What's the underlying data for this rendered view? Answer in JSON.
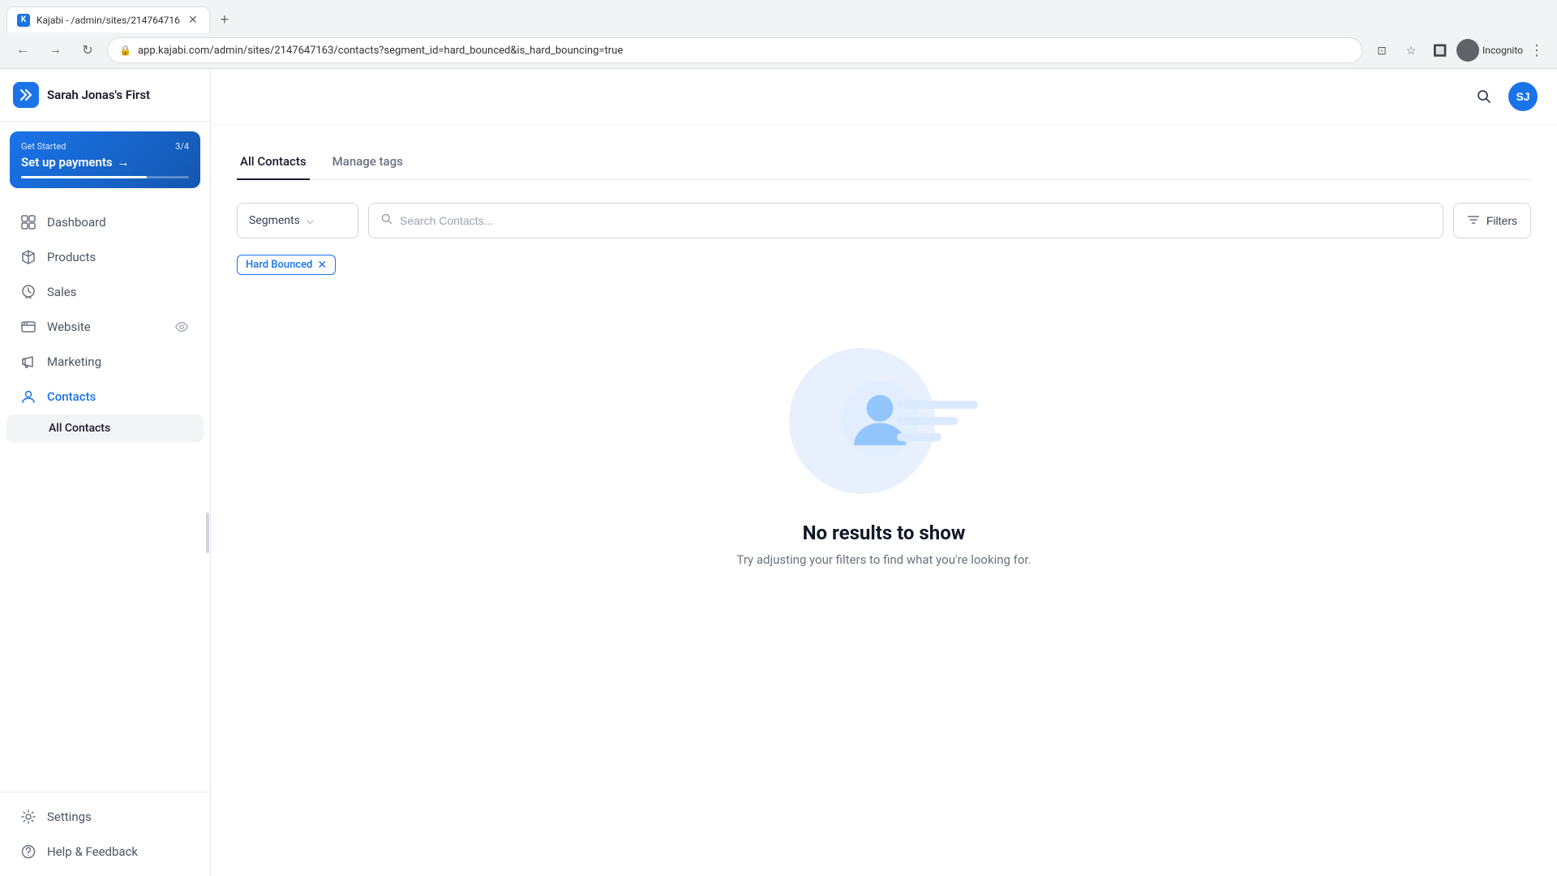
{
  "browser": {
    "tab_title": "Kajabi - /admin/sites/214764716",
    "tab_favicon": "K",
    "url": "app.kajabi.com/admin/sites/2147647163/contacts?segment_id=hard_bounced&is_hard_bouncing=true",
    "incognito_label": "Incognito"
  },
  "header": {
    "site_name": "Sarah Jonas's First",
    "logo_text": "K",
    "user_initials": "SJ"
  },
  "sidebar": {
    "get_started": {
      "label": "Get Started",
      "progress": "3/4",
      "title": "Set up payments",
      "arrow": "→"
    },
    "nav_items": [
      {
        "id": "dashboard",
        "label": "Dashboard",
        "icon": "dashboard"
      },
      {
        "id": "products",
        "label": "Products",
        "icon": "products"
      },
      {
        "id": "sales",
        "label": "Sales",
        "icon": "sales"
      },
      {
        "id": "website",
        "label": "Website",
        "icon": "website",
        "badge": "eye"
      },
      {
        "id": "marketing",
        "label": "Marketing",
        "icon": "marketing"
      },
      {
        "id": "contacts",
        "label": "Contacts",
        "icon": "contacts",
        "active": true
      }
    ],
    "sub_items": [
      {
        "id": "all-contacts",
        "label": "All Contacts",
        "active": true
      }
    ],
    "footer_items": [
      {
        "id": "settings",
        "label": "Settings",
        "icon": "settings"
      },
      {
        "id": "help",
        "label": "Help & Feedback",
        "icon": "help"
      }
    ]
  },
  "main": {
    "tabs": [
      {
        "id": "all-contacts",
        "label": "All Contacts",
        "active": true
      },
      {
        "id": "manage-tags",
        "label": "Manage tags",
        "active": false
      }
    ],
    "filters": {
      "segments_label": "Segments",
      "search_placeholder": "Search Contacts...",
      "filters_label": "Filters"
    },
    "active_filters": [
      {
        "id": "hard-bounced",
        "label": "Hard Bounced"
      }
    ],
    "empty_state": {
      "title": "No results to show",
      "subtitle": "Try adjusting your filters to find what you're looking for."
    }
  }
}
